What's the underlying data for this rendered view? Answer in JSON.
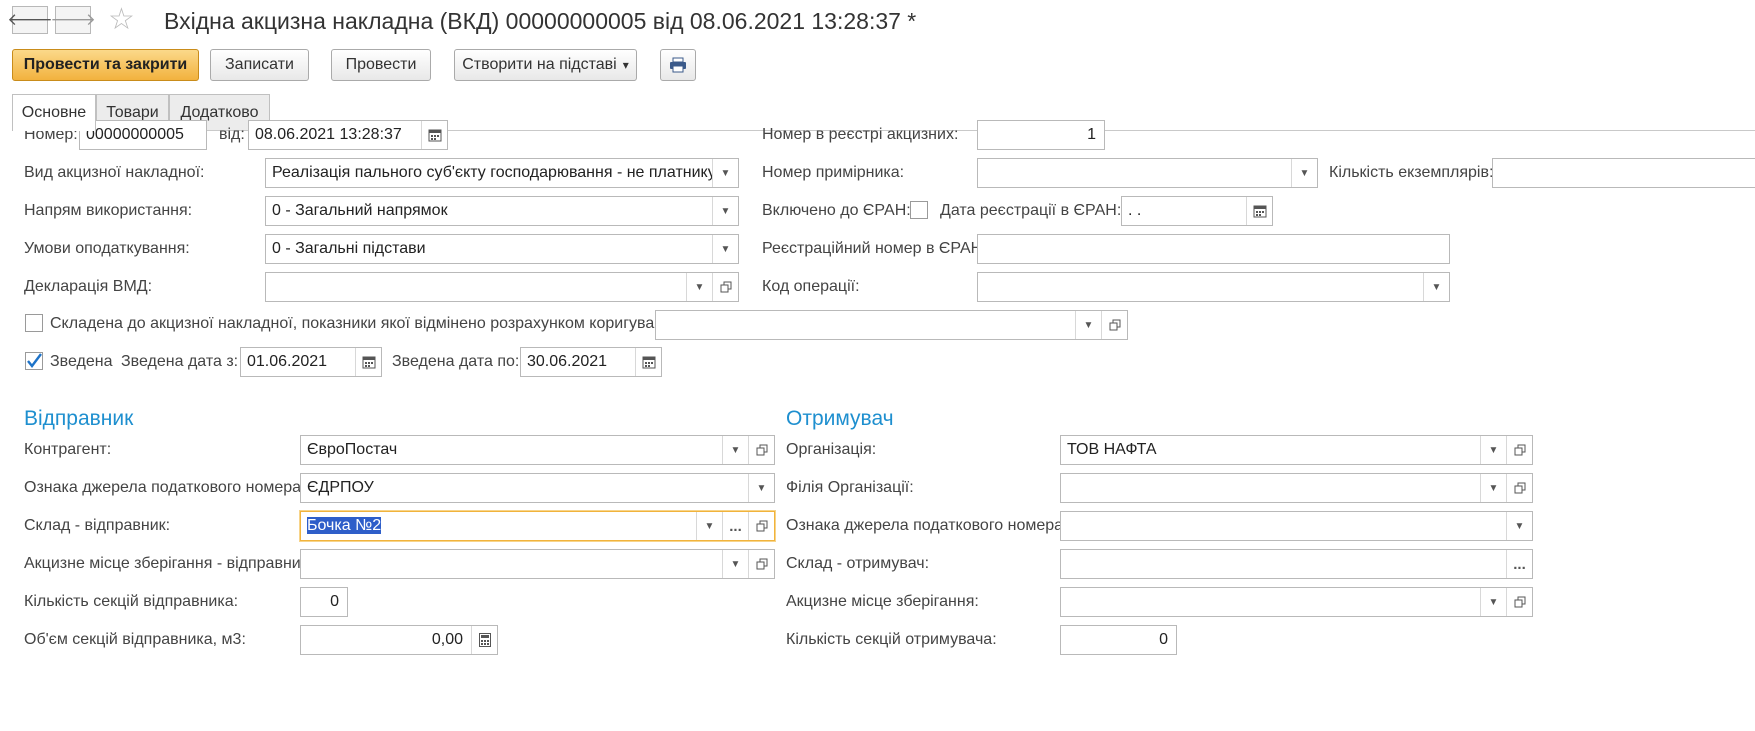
{
  "window": {
    "title": "Вхідна акцизна накладна (ВКД) 00000000005 від 08.06.2021 13:28:37 *",
    "back_glyph": "🡐",
    "forward_glyph": "🡒",
    "favorite_glyph": "☆"
  },
  "toolbar": {
    "post_and_close": "Провести та закрити",
    "save": "Записати",
    "post": "Провести",
    "create_based_on": "Створити на підставі",
    "dropdown_glyph": "▾"
  },
  "tabs": [
    {
      "label": "Основне",
      "active": true
    },
    {
      "label": "Товари",
      "active": false
    },
    {
      "label": "Додатково",
      "active": false
    }
  ],
  "header": {
    "number_label": "Номер:",
    "number_value": "00000000005",
    "date_label": "від:",
    "date_value": "08.06.2021 13:28:37",
    "invoice_type_label": "Вид акцизної накладної:",
    "invoice_type_value": "Реалізація пального суб'єкту господарювання - не платнику",
    "direction_label": "Напрям використання:",
    "direction_value": "0 - Загальний напрямок",
    "tax_terms_label": "Умови оподаткування:",
    "tax_terms_value": "0 - Загальні підстави",
    "customs_decl_label": "Декларація ВМД:",
    "customs_decl_value": "",
    "registry_number_label": "Номер в реєстрі акцизних:",
    "registry_number_value": "1",
    "copy_number_label": "Номер примірника:",
    "copy_number_value": "",
    "copies_count_label": "Кількість екземплярів:",
    "copies_count_value": "",
    "included_eran_label": "Включено до ЄРАН:",
    "included_eran_checked": false,
    "eran_date_label": "Дата реєстрації в ЄРАН:",
    "eran_date_value": " .  .",
    "eran_regnum_label": "Реєстраційний номер в ЄРАН:",
    "eran_regnum_value": "",
    "operation_code_label": "Код операції:",
    "operation_code_value": "",
    "correction_label": "Складена до акцизної накладної, показники якої відмінено розрахунком коригування",
    "correction_checked": false,
    "correction_value": "",
    "consolidated_label": "Зведена",
    "consolidated_checked": true,
    "consolidated_from_label": "Зведена дата з:",
    "consolidated_from_value": "01.06.2021",
    "consolidated_to_label": "Зведена дата по:",
    "consolidated_to_value": "30.06.2021"
  },
  "sender": {
    "title": "Відправник",
    "counterparty_label": "Контрагент:",
    "counterparty_value": "ЄвроПостач",
    "tax_source_label": "Ознака джерела податкового номера:",
    "tax_source_value": "ЄДРПОУ",
    "warehouse_label": "Склад - відправник:",
    "warehouse_value": "Бочка №2",
    "excise_place_label": "Акцизне місце зберігання - відправник:",
    "excise_place_value": "",
    "sections_count_label": "Кількість секцій відправника:",
    "sections_count_value": "0",
    "sections_volume_label": "Об'єм секцій відправника, м3:",
    "sections_volume_value": "0,00"
  },
  "receiver": {
    "title": "Отримувач",
    "organization_label": "Організація:",
    "organization_value": "ТОВ НАФТА",
    "branch_label": "Філія Організації:",
    "branch_value": "",
    "tax_source_label": "Ознака джерела податкового номера:",
    "tax_source_value": "",
    "warehouse_label": "Склад - отримувач:",
    "warehouse_value": "",
    "excise_place_label": "Акцизне місце зберігання:",
    "excise_place_value": "",
    "sections_count_label": "Кількість секцій отримувача:",
    "sections_count_value": "0"
  },
  "icons": {
    "dropdown": "▼",
    "open": "open-window-icon",
    "calendar": "calendar-icon",
    "select": "..."
  },
  "colors": {
    "accent_section": "#1e8fcf",
    "primary_button": "#f2b23e",
    "focus_border": "#f1b33c",
    "selection": "#2e5ec9"
  }
}
